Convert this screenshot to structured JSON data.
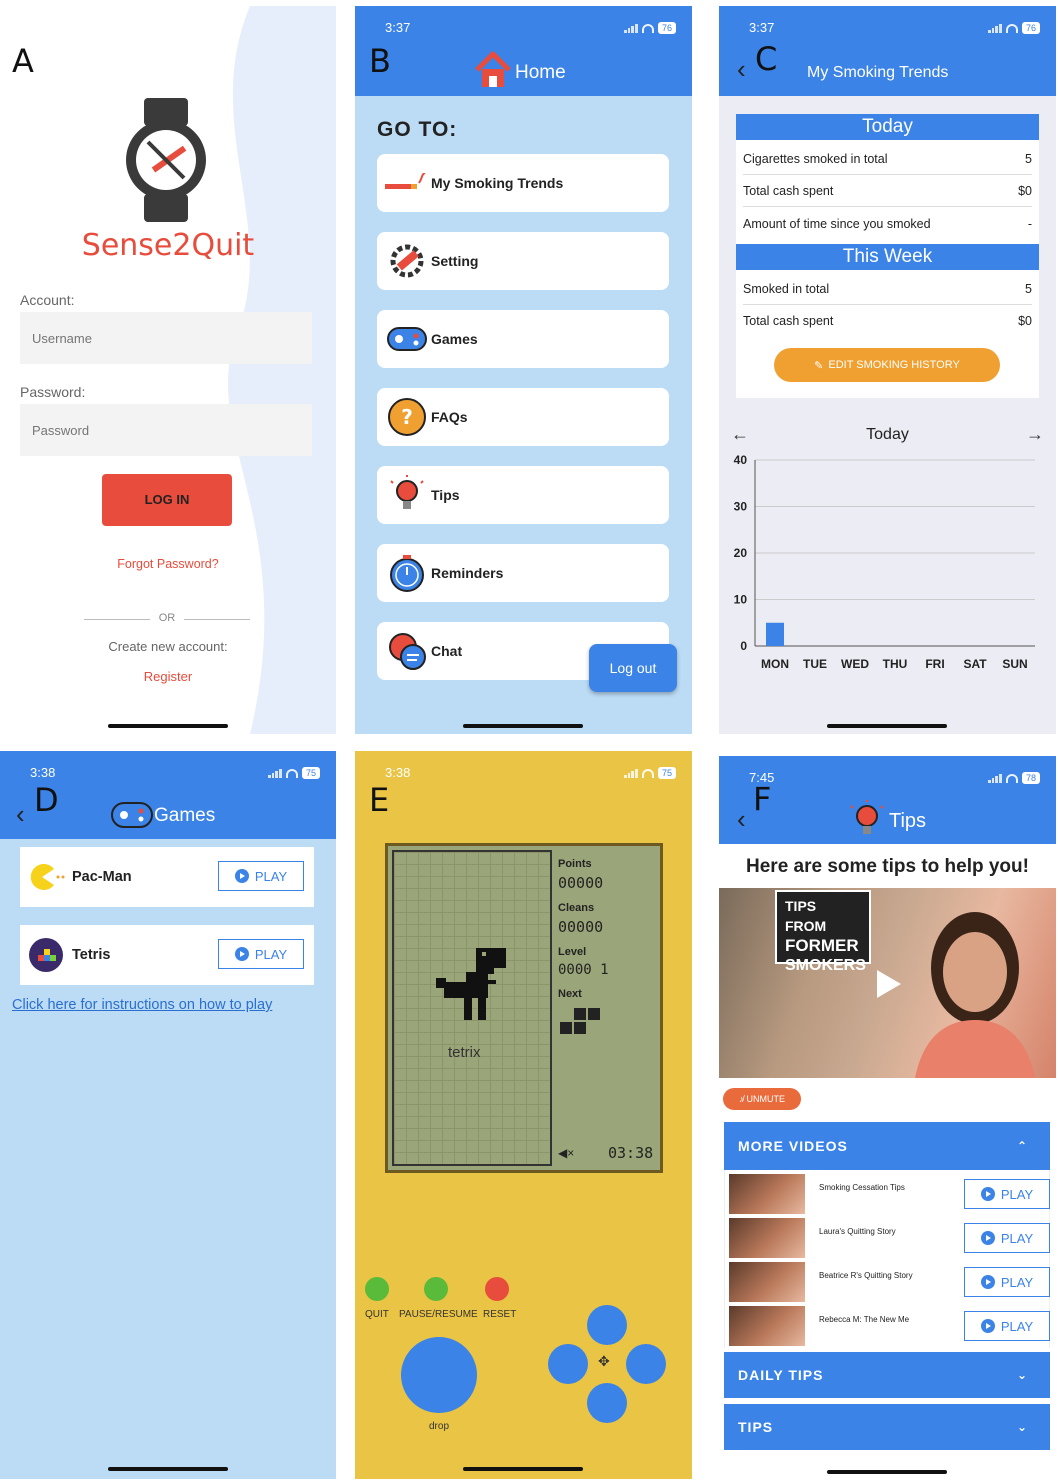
{
  "panel_a": {
    "letter": "A",
    "brand": "Sense2Quit",
    "account_label": "Account:",
    "username_placeholder": "Username",
    "password_label": "Password:",
    "password_placeholder": "Password",
    "login_label": "LOG IN",
    "forgot_label": "Forgot Password?",
    "or_label": "OR",
    "create_label": "Create new account:",
    "register_label": "Register"
  },
  "panel_b": {
    "letter": "B",
    "time": "3:37",
    "battery": "76",
    "title": "Home",
    "goto_label": "GO TO:",
    "items": [
      "My Smoking Trends",
      "Setting",
      "Games",
      "FAQs",
      "Tips",
      "Reminders",
      "Chat"
    ],
    "logout_label": "Log out"
  },
  "panel_c": {
    "letter": "C",
    "time": "3:37",
    "battery": "76",
    "back": "‹",
    "title": "My Smoking Trends",
    "today_header": "Today",
    "today_rows": [
      {
        "label": "Cigarettes smoked in total",
        "value": "5"
      },
      {
        "label": "Total cash spent",
        "value": "$0"
      },
      {
        "label": "Amount of time since you smoked",
        "value": "-"
      }
    ],
    "week_header": "This Week",
    "week_rows": [
      {
        "label": "Smoked in total",
        "value": "5"
      },
      {
        "label": "Total cash spent",
        "value": "$0"
      }
    ],
    "edit_label": "EDIT SMOKING HISTORY",
    "prev_arrow": "←",
    "next_arrow": "→"
  },
  "chart_data": {
    "type": "bar",
    "title": "Today",
    "categories": [
      "MON",
      "TUE",
      "WED",
      "THU",
      "FRI",
      "SAT",
      "SUN"
    ],
    "values": [
      5,
      0,
      0,
      0,
      0,
      0,
      0
    ],
    "yticks": [
      0,
      10,
      20,
      30,
      40
    ],
    "ylim": [
      0,
      40
    ],
    "grid": true,
    "bar_color": "#3b83e6"
  },
  "panel_d": {
    "letter": "D",
    "time": "3:38",
    "battery": "75",
    "back": "‹",
    "title": "Games",
    "games": [
      {
        "name": "Pac-Man",
        "play": "PLAY"
      },
      {
        "name": "Tetris",
        "play": "PLAY"
      }
    ],
    "instructions_link": "Click here for instructions on how to play"
  },
  "panel_e": {
    "letter": "E",
    "time": "3:38",
    "battery": "75",
    "points_label": "Points",
    "points_value": "00000",
    "cleans_label": "Cleans",
    "cleans_value": "00000",
    "level_label": "Level",
    "level_value": "0000 1",
    "next_label": "Next",
    "game_text": "tetrix",
    "clock": "03:38",
    "quit_label": "QUIT",
    "pause_label": "PAUSE/RESUME",
    "reset_label": "RESET",
    "drop_label": "drop"
  },
  "panel_f": {
    "letter": "F",
    "time": "7:45",
    "battery": "78",
    "back": "‹",
    "title": "Tips",
    "headline": "Here are some tips to help you!",
    "video_banner": [
      "TIPS FROM",
      "FORMER",
      "SMOKERS"
    ],
    "unmute_label": "UNMUTE",
    "more_videos_label": "MORE VIDEOS",
    "videos": [
      {
        "title": "Smoking Cessation Tips",
        "play": "PLAY"
      },
      {
        "title": "Laura's Quitting Story",
        "play": "PLAY"
      },
      {
        "title": "Beatrice R's Quitting Story",
        "play": "PLAY"
      },
      {
        "title": "Rebecca M: The New Me",
        "play": "PLAY"
      }
    ],
    "daily_tips_label": "DAILY TIPS",
    "tips_label": "TIPS"
  },
  "colors": {
    "blue": "#3b83e6",
    "light_blue": "#bcdcf6",
    "red": "#e74c3c",
    "orange": "#f0a030",
    "yellow": "#eac545"
  }
}
